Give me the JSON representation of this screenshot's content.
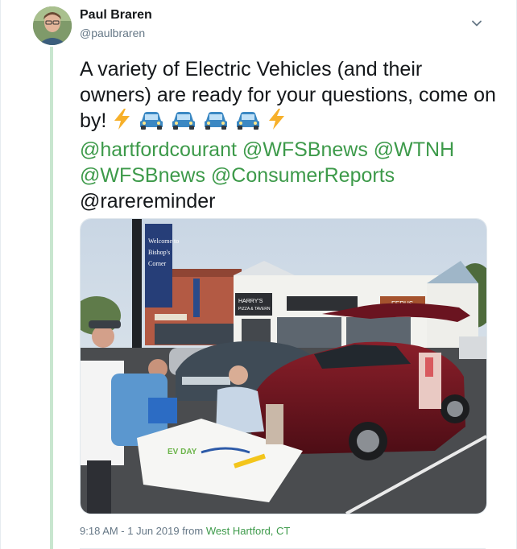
{
  "tweet": {
    "author_name": "Paul Braren",
    "author_handle": "@paulbraren",
    "text_line1": "A variety of Electric Vehicles (and their owners) are ready for your questions, come on by!",
    "mentions": [
      "@hartfordcourant",
      "@WFSBnews",
      "@WTNH",
      "@WFSBnews",
      "@ConsumerReports",
      "@rarereminder"
    ],
    "emojis": [
      "zap",
      "car",
      "car",
      "car",
      "car",
      "zap"
    ],
    "timestamp": "9:18 AM - 1 Jun 2019",
    "from_label": "from",
    "location": "West Hartford, CT"
  },
  "photo": {
    "sign_lines": [
      "Welcome to",
      "Bishop's",
      "Corner"
    ],
    "storefronts": [
      "HARRY'S",
      "PIZZA & TAVERN",
      "FERUS"
    ],
    "table_sign": "EV DAY"
  },
  "colors": {
    "link": "#3d9a4a",
    "thread": "#c8e6cf",
    "muted": "#657786"
  }
}
